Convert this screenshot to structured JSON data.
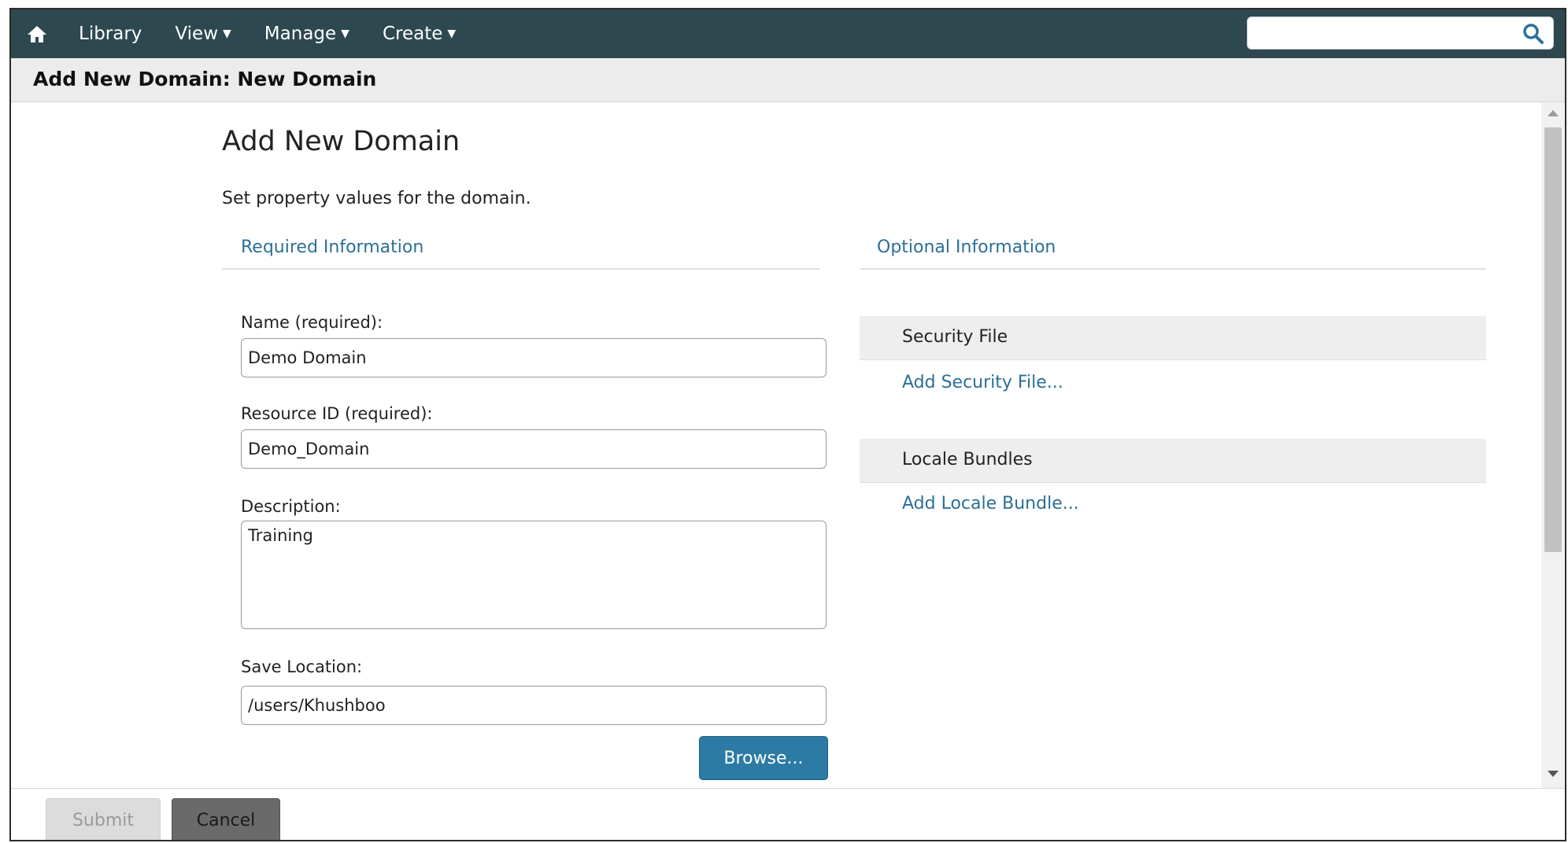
{
  "nav": {
    "home_icon": "home-icon",
    "items": [
      {
        "label": "Library",
        "dropdown": false
      },
      {
        "label": "View",
        "dropdown": true
      },
      {
        "label": "Manage",
        "dropdown": true
      },
      {
        "label": "Create",
        "dropdown": true
      }
    ],
    "search": {
      "value": "",
      "icon": "search-icon"
    },
    "background_color": "#2e4850"
  },
  "titlebar": {
    "title": "Add New Domain: New Domain"
  },
  "main": {
    "heading": "Add New Domain",
    "intro": "Set property values for the domain.",
    "required_section": {
      "title": "Required Information",
      "fields": {
        "name": {
          "label": "Name (required):",
          "value": "Demo Domain"
        },
        "resource_id": {
          "label": "Resource ID (required):",
          "value": "Demo_Domain"
        },
        "description": {
          "label": "Description:",
          "value": "Training"
        },
        "save_location": {
          "label": "Save Location:",
          "value": "/users/Khushboo"
        }
      },
      "browse_label": "Browse..."
    },
    "optional_section": {
      "title": "Optional Information",
      "security_file": {
        "title": "Security File",
        "link": "Add Security File..."
      },
      "locale_bundles": {
        "title": "Locale Bundles",
        "link": "Add Locale Bundle..."
      }
    }
  },
  "footer": {
    "submit_label": "Submit",
    "cancel_label": "Cancel"
  },
  "colors": {
    "link": "#2b6f98",
    "browse_button": "#2c7ba4",
    "cancel_button": "#6a6a6a"
  }
}
